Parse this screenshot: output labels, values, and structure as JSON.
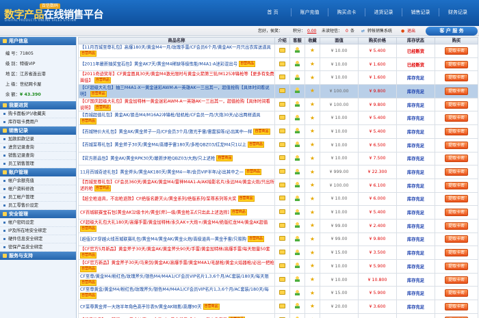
{
  "header": {
    "logo_text": "数字产品",
    "logo_text2": "在线销售平台",
    "logo_tag": "百信数码",
    "logo_sub": "DIGITAL PRODUCTS ONLINE SALES SYSTEM",
    "nav": [
      "首 页",
      "账户充值",
      "购买点卡",
      "进货记录",
      "销售记录",
      "财务记录"
    ]
  },
  "infobar": {
    "greeting": "您好，侯笑：",
    "points_label": "积分：",
    "points_value": "0.00",
    "unread_label": "未读短信：",
    "unread_value": "0",
    "unread_unit": "条",
    "transfer": "转帐销售系统",
    "exit": "退出",
    "service": "客 户 服 务"
  },
  "sidebar": {
    "user_title": "用户信息",
    "user": [
      "编 号：71805",
      "级 别：特级VIP",
      "地 区：江苏省连云港",
      "上 级：世纪网卡屋"
    ],
    "balance_label": "余 额：",
    "balance": "¥ 43.390",
    "sections": [
      {
        "title": "我要进货",
        "items": [
          "购卡面板(P)/收藏夹",
          "库存取卡费用户"
        ]
      },
      {
        "title": "销售记录",
        "items": [
          "加款扣款记录",
          "进货记录查询",
          "销售记录查询",
          "员工销售管理"
        ]
      },
      {
        "title": "账户管理",
        "items": [
          "帐户余额充值",
          "帐户资料修改",
          "员工帐户管理",
          "员工零售价设定"
        ]
      },
      {
        "title": "安全管理",
        "items": [
          "帐户密码设定",
          "IP及所在地安全绑定",
          "硬件信息安全绑定",
          "密保产品安全绑定"
        ]
      },
      {
        "title": "服务与支持",
        "items": []
      }
    ]
  },
  "table": {
    "headers": [
      "商品名称",
      "介绍",
      "客服",
      "收藏",
      "面值",
      "购买价格",
      "库存状态",
      "购买"
    ],
    "rows": [
      {
        "name": "【11月百城至尊礼包】高爆180天/黄金M4一月/玫瑰手雷/CF会员6个月/黄金AK一月只出衣库送道具",
        "badge": "自营商品",
        "face": "¥ 10.00",
        "price": "¥ 5.400",
        "status": "已经断货",
        "sold": true,
        "red": false,
        "hl": false,
        "buy": "提取卡密"
      },
      {
        "name": "【2011年最新抽奖宝石包】黄金AK7天/黄金M4稀缺等级性能/M4A1-A迷彩混出号",
        "badge": "自营商品",
        "face": "¥ 10.00",
        "price": "¥ 1.600",
        "status": "已经断货",
        "sold": true,
        "red": false,
        "hl": false,
        "buy": "提取卡密"
      },
      {
        "name": "【2011奇迹奖年】CF黄金面具30天/黄金M4激光限时与黄金火箭第三轮/M125冲锋枪等【更多有免费面值】",
        "badge": "自营商品",
        "face": "¥ 10.00",
        "price": "¥ 1.600",
        "status": "库存充足",
        "sold": false,
        "red": true,
        "hl": false,
        "buy": "提取卡密"
      },
      {
        "name": "【CF超级大礼包】抽三M4A1-X一黄金迷彩AWM-A一英雄AK一三出其一，超值抢购【具体时间看说明】",
        "badge": "自营商品",
        "face": "¥ 100.00",
        "price": "¥ 9.800",
        "status": "库存充足",
        "sold": false,
        "red": false,
        "hl": true,
        "buy": "提取卡密"
      },
      {
        "name": "【CF国庆超级大礼包】黄金加特林一黄金迷彩AWM-A一英雄AK一三出其一，超值抢购【具体时间看说明】",
        "badge": "自营商品",
        "face": "¥ 100.00",
        "price": "¥ 9.800",
        "status": "库存充足",
        "sold": false,
        "red": true,
        "hl": false,
        "buy": "提取卡密"
      },
      {
        "name": "【百城超值礼包】黄金AK/狙击M4/M16A2冲锋枪/轻机枪/CF会员一月/大炮30天/必出两样道具",
        "badge": "自营商品",
        "face": "¥ 10.00",
        "price": "¥ 5.400",
        "status": "库存充足",
        "sold": false,
        "red": false,
        "hl": false,
        "buy": "提取卡密"
      },
      {
        "name": "【百城特价大礼包】黄金AK/黄金斧子一月/CF会员3个月/激光手雷/雷霆狙等/必出其中一样",
        "badge": "自营商品",
        "face": "¥ 10.00",
        "price": "¥ 5.400",
        "status": "库存充足",
        "sold": false,
        "red": false,
        "hl": false,
        "buy": "提取卡密"
      },
      {
        "name": "【百城至尊礼包】黄金斧子30天/黄金M4/高爆手雷180天/多枪QBZ03/红龙M4只1以上",
        "badge": "自营商品",
        "face": "¥ 10.00",
        "price": "¥ 6.500",
        "status": "库存充足",
        "sold": false,
        "red": false,
        "hl": false,
        "buy": "提取卡密"
      },
      {
        "name": "【官方新品包】黄金AK/黄金RPK30天/最新步枪QBZ03/大炮/只上述枪",
        "badge": "自营商品",
        "face": "¥ 10.00",
        "price": "¥ 7.500",
        "status": "库存充足",
        "sold": false,
        "red": false,
        "hl": false,
        "buy": "提取卡密"
      },
      {
        "name": "11月百城奇迹礼包】黄金斧头/黄金AK180天/黄金M4一年/会员VIP半年/必出其中之一",
        "badge": "自营商品",
        "face": "¥ 999.00",
        "price": "¥ 22.300",
        "status": "库存充足",
        "sold": false,
        "red": false,
        "hl": false,
        "buy": "提取卡密"
      },
      {
        "name": "【百城至尊礼包】CF会员360天/黄金AK/黄金M4/雷神M4A1-A/AK暗影名片/永远M4/黄金火炮/只出所述的枪",
        "badge": "自营商品",
        "face": "¥ 100.00",
        "price": "¥ 6.100",
        "status": "库存充足",
        "sold": false,
        "red": true,
        "hl": false,
        "buy": "提取卡密"
      },
      {
        "name": "【超全枪道具，不出枪退款】CF绝版名爵天火/黄金系列/绝版系列/至尊系列等大奖",
        "badge": "自营商品",
        "face": "¥ 10.00",
        "price": "¥ 6.000",
        "status": "库存充足",
        "sold": false,
        "red": true,
        "hl": false,
        "buy": "提取卡密"
      },
      {
        "name": "CF百城联赛宝石包[黄金AK]2级卡片/黄金[斧]一级/黄金枪王/[只出此上述选择]",
        "badge": "自营商品",
        "face": "¥ 10.00",
        "price": "¥ 5.400",
        "status": "库存充足",
        "sold": false,
        "red": true,
        "hl": false,
        "buy": "提取卡密"
      },
      {
        "name": "CF超级大礼包大礼180天/高爆手雷/黄金加特林/永久AK+大炮+/黄金M4/绝版红龙M4/黄金AK超值",
        "badge": "自营商品",
        "face": "¥ 99.00",
        "price": "¥ 2.400",
        "status": "库存充足",
        "sold": false,
        "red": true,
        "hl": false,
        "buy": "提取卡密"
      },
      {
        "name": "[超值]CF穿越火线百城联赛礼包/黄金M4/黄金AK/黄金火炮/高级道具一黄金手雷/只限购",
        "badge": "自营商品",
        "face": "¥ 99.00",
        "price": "¥ 9.800",
        "status": "库存充足",
        "sold": false,
        "red": false,
        "hl": false,
        "buy": "提取卡密"
      },
      {
        "name": "【CF官方5月新品】黄金斧子30天/黄金AK/黄金斧头90天/手雷/黄金加特林/高爆手雷/每天限量50套",
        "badge": "自营商品",
        "face": "¥ 15.00",
        "price": "¥ 3.500",
        "status": "库存充足",
        "sold": false,
        "red": true,
        "hl": false,
        "buy": "提取卡密"
      },
      {
        "name": "【CF官方新品】黄金斧子30天/马来剑/黄金AK/高爆手雷/黄金M4A1/毛瑟枪/黄金火焰器枪/必出一把枪",
        "badge": "自营商品",
        "face": "¥ 10.00",
        "price": "¥ 5.900",
        "status": "库存充足",
        "sold": false,
        "red": true,
        "hl": false,
        "buy": "提取卡密"
      },
      {
        "name": "CF至尊/黄金M4/粉红色/玫瑰斧头/银色M4/M4A1/CF会员VIP名片1,3,6个月/AC套装/180天/每天限",
        "badge": "自营商品",
        "face": "¥ 10.00",
        "price": "¥ 10.800",
        "status": "库存充足",
        "sold": false,
        "red": false,
        "hl": false,
        "buy": "提取卡密"
      },
      {
        "name": "CF至尊黄金/黄金M4/粉红色/玫瑰斧头/银色M4/M4A1/CF会员VIP名片1,3,6个月/AC套装/180天/每",
        "badge": "自营商品",
        "face": "¥ 15.00",
        "price": "¥ 5.900",
        "status": "库存充足",
        "sold": false,
        "red": false,
        "hl": false,
        "buy": "提取卡密"
      },
      {
        "name": "CF至尊黄金斧一大炮半年角色高手珍表9/黄金AK暗影/高爆90天",
        "badge": "自营商品",
        "face": "¥ 20.00",
        "price": "¥ 3.600",
        "status": "库存充足",
        "sold": false,
        "red": false,
        "hl": false,
        "buy": "提取卡密"
      },
      {
        "name": "【超值抢卖】CF新版CDK黄金沙鹰/CF会员1年/黄金斧子/永久M4/每个几率最",
        "badge": "自营商品",
        "face": "¥ 10.00",
        "price": "¥ 3.400",
        "status": "库存充足",
        "sold": false,
        "red": true,
        "hl": false,
        "buy": "提取卡密"
      }
    ]
  }
}
